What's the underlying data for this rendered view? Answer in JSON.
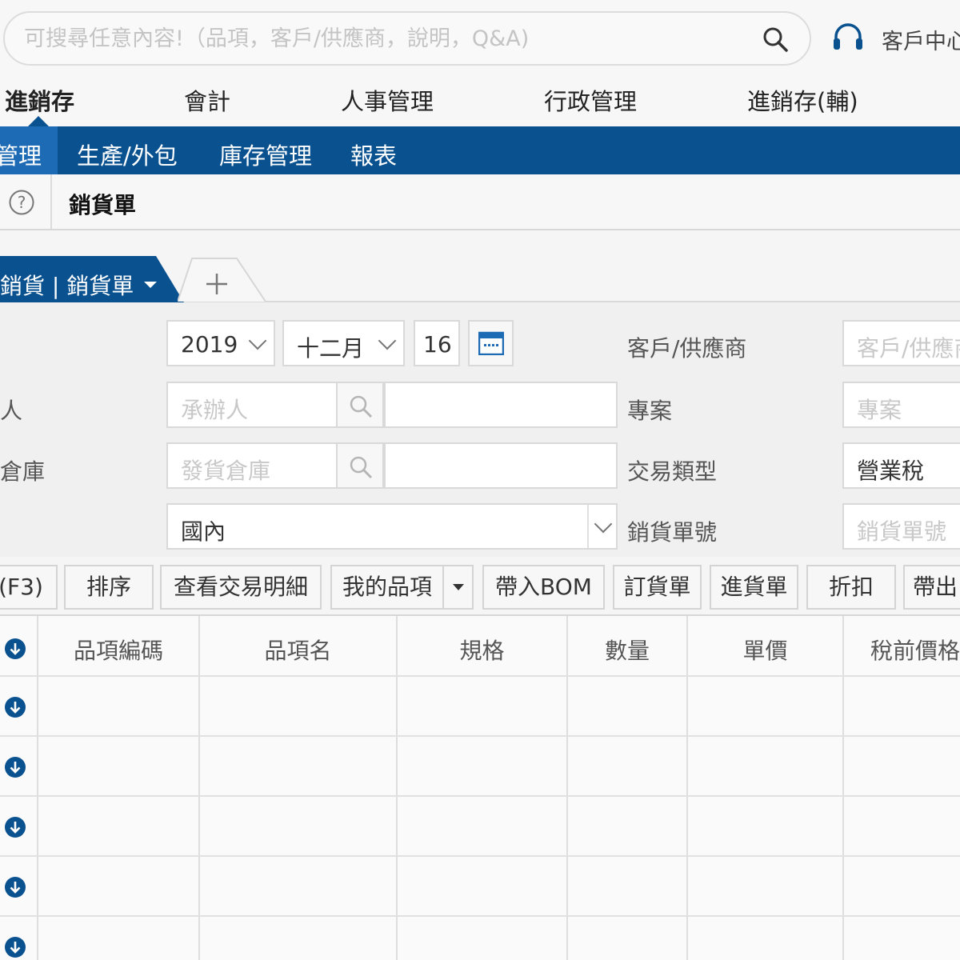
{
  "search": {
    "placeholder": "可搜尋任意內容!（品項，客戶/供應商，說明，Q&A)"
  },
  "header": {
    "customer_center": "客戶中心"
  },
  "modules": [
    "進銷存",
    "會計",
    "人事管理",
    "行政管理",
    "進銷存(輔)"
  ],
  "submenu": [
    "管理",
    "生產/外包",
    "庫存管理",
    "報表"
  ],
  "page": {
    "title": "銷貨單"
  },
  "doc_tab": {
    "label": "銷貨 | 銷貨單",
    "add": "+"
  },
  "form": {
    "year": "2019",
    "month": "十二月",
    "day": "16",
    "labels": {
      "handler": "人",
      "warehouse": "倉庫",
      "customer": "客戶/供應商",
      "project": "專案",
      "trade_type": "交易類型",
      "sales_no": "銷貨單號"
    },
    "placeholders": {
      "handler": "承辦人",
      "warehouse": "發貨倉庫",
      "customer": "客戶/供應商",
      "project": "專案",
      "sales_no": "銷貨單號"
    },
    "domestic": "國內",
    "trade_type_value": "營業稅"
  },
  "toolbar": [
    "(F3)",
    "排序",
    "查看交易明細",
    "我的品項",
    "帶入BOM",
    "訂貨單",
    "進貨單",
    "折扣",
    "帶出"
  ],
  "table": {
    "columns": [
      "品項編碼",
      "品項名",
      "規格",
      "數量",
      "單價",
      "稅前價格"
    ],
    "row_count": 5
  },
  "colors": {
    "primary": "#0a5190",
    "active_sub": "#1d6bb4"
  }
}
